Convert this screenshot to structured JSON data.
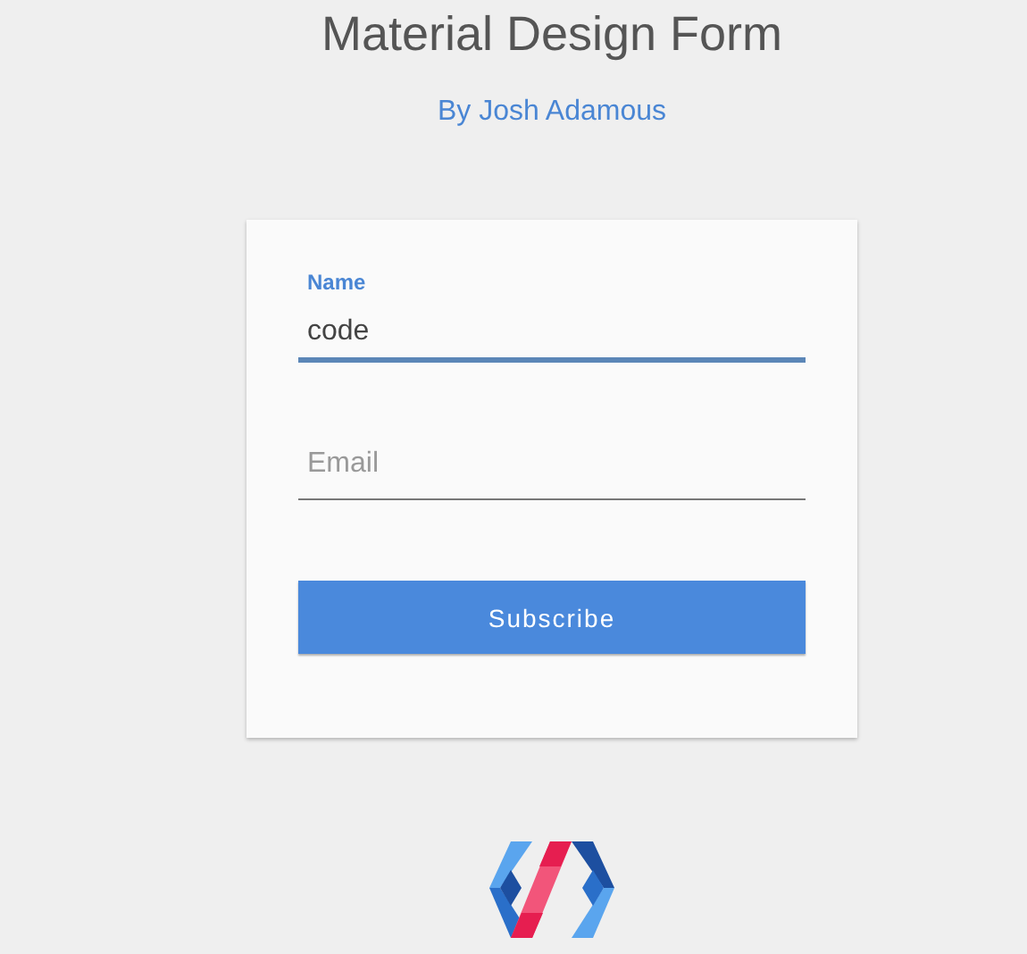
{
  "header": {
    "title": "Material Design Form",
    "byline": "By Josh Adamous"
  },
  "form": {
    "fields": [
      {
        "label": "Name",
        "value": "code",
        "focused": true
      },
      {
        "label": "Email",
        "focused": false
      }
    ],
    "button": "Subscribe"
  }
}
